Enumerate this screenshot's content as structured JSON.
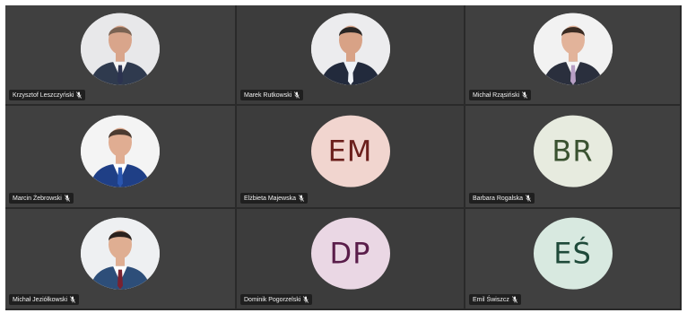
{
  "participants": [
    {
      "name": "Krzysztof Leszczyński",
      "avatar": {
        "type": "photo",
        "icon": "person-photo-icon",
        "bg": "#e8e8ea",
        "suit": "#2f3a4e",
        "shirt": "#f3f3f3",
        "tie": "#2c3350",
        "skin": "#d9a58b",
        "hair": "#7a6252"
      }
    },
    {
      "name": "Marek Rutkowski",
      "avatar": {
        "type": "photo",
        "icon": "person-photo-icon",
        "bg": "#ececee",
        "suit": "#222a3c",
        "shirt": "#eef2f7",
        "tie": "#eef2f7",
        "skin": "#d8a286",
        "hair": "#2a2624"
      }
    },
    {
      "name": "Michał Rząsiński",
      "avatar": {
        "type": "photo",
        "icon": "person-photo-icon",
        "bg": "#f2f2f2",
        "suit": "#2a2f3d",
        "shirt": "#f5f5f5",
        "tie": "#b79ec4",
        "skin": "#e2b39a",
        "hair": "#3a2b22"
      }
    },
    {
      "name": "Marcin Żebrowski",
      "avatar": {
        "type": "photo",
        "icon": "person-photo-icon",
        "bg": "#f4f4f4",
        "suit": "#1f3f86",
        "shirt": "#ffffff",
        "tie": "#2a56b0",
        "skin": "#e0ad92",
        "hair": "#4a3a30"
      }
    },
    {
      "name": "Elżbieta Majewska",
      "avatar": {
        "type": "initials",
        "initials": "EM",
        "bg": "#f1d5cf",
        "fg": "#6b1f1c"
      }
    },
    {
      "name": "Barbara Rogalska",
      "avatar": {
        "type": "initials",
        "initials": "BR",
        "bg": "#e7ebdf",
        "fg": "#3a5230"
      }
    },
    {
      "name": "Michał Jeziółkowski",
      "avatar": {
        "type": "photo",
        "icon": "person-photo-icon",
        "bg": "#eef0f2",
        "suit": "#2d4e79",
        "shirt": "#ffffff",
        "tie": "#7a2230",
        "skin": "#dfae92",
        "hair": "#2a211d"
      }
    },
    {
      "name": "Dominik Pogorzelski",
      "avatar": {
        "type": "initials",
        "initials": "DP",
        "bg": "#ead7e4",
        "fg": "#5a1d4a"
      }
    },
    {
      "name": "Emil Świszcz",
      "avatar": {
        "type": "initials",
        "initials": "EŚ",
        "bg": "#d8e9e0",
        "fg": "#1f4a3a"
      }
    }
  ],
  "mic_icon": "mic-muted-icon",
  "colors": {
    "tile_bg": "#404040",
    "tag_bg": "#1f1f1f",
    "tag_text": "#f0f0f0"
  }
}
